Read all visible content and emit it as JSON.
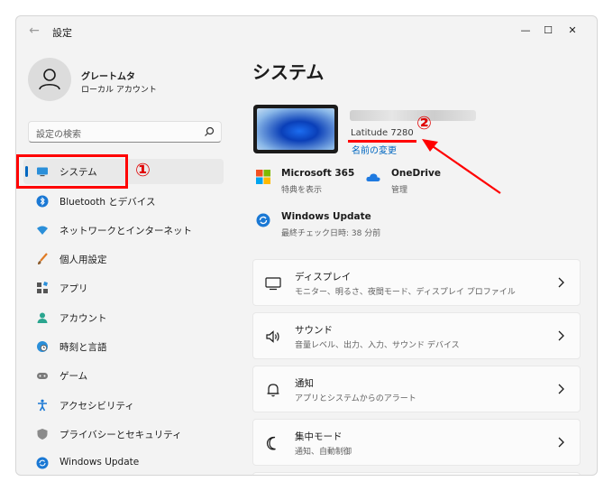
{
  "window": {
    "title": "設定"
  },
  "profile": {
    "name": "グレートムタ",
    "account_type": "ローカル アカウント"
  },
  "search": {
    "placeholder": "設定の検索"
  },
  "sidebar": {
    "items": [
      {
        "label": "システム",
        "icon": "monitor-icon",
        "active": true
      },
      {
        "label": "Bluetooth とデバイス",
        "icon": "bluetooth-icon"
      },
      {
        "label": "ネットワークとインターネット",
        "icon": "network-icon"
      },
      {
        "label": "個人用設定",
        "icon": "brush-icon"
      },
      {
        "label": "アプリ",
        "icon": "apps-icon"
      },
      {
        "label": "アカウント",
        "icon": "account-icon"
      },
      {
        "label": "時刻と言語",
        "icon": "globe-clock-icon"
      },
      {
        "label": "ゲーム",
        "icon": "gamepad-icon"
      },
      {
        "label": "アクセシビリティ",
        "icon": "accessibility-icon"
      },
      {
        "label": "プライバシーとセキュリティ",
        "icon": "shield-icon"
      },
      {
        "label": "Windows Update",
        "icon": "update-icon"
      }
    ]
  },
  "main": {
    "title": "システム",
    "device": {
      "model": "Latitude 7280",
      "rename_link": "名前の変更"
    },
    "tiles": [
      {
        "title": "Microsoft 365",
        "subtitle": "特典を表示",
        "icon": "microsoft-logo-icon"
      },
      {
        "title": "OneDrive",
        "subtitle": "管理",
        "icon": "cloud-icon"
      },
      {
        "title": "Windows Update",
        "subtitle": "最終チェック日時: 38 分前",
        "icon": "update-icon"
      }
    ],
    "cards": [
      {
        "title": "ディスプレイ",
        "subtitle": "モニター、明るさ、夜間モード、ディスプレイ プロファイル",
        "icon": "display-icon"
      },
      {
        "title": "サウンド",
        "subtitle": "音量レベル、出力、入力、サウンド デバイス",
        "icon": "speaker-icon"
      },
      {
        "title": "通知",
        "subtitle": "アプリとシステムからのアラート",
        "icon": "bell-icon"
      },
      {
        "title": "集中モード",
        "subtitle": "通知、自動制御",
        "icon": "moon-icon"
      }
    ]
  },
  "annotations": {
    "step1": "①",
    "step2": "②",
    "color": "#ff0000"
  },
  "colors": {
    "accent": "#0067c0",
    "window_bg": "#f3f3f3"
  }
}
